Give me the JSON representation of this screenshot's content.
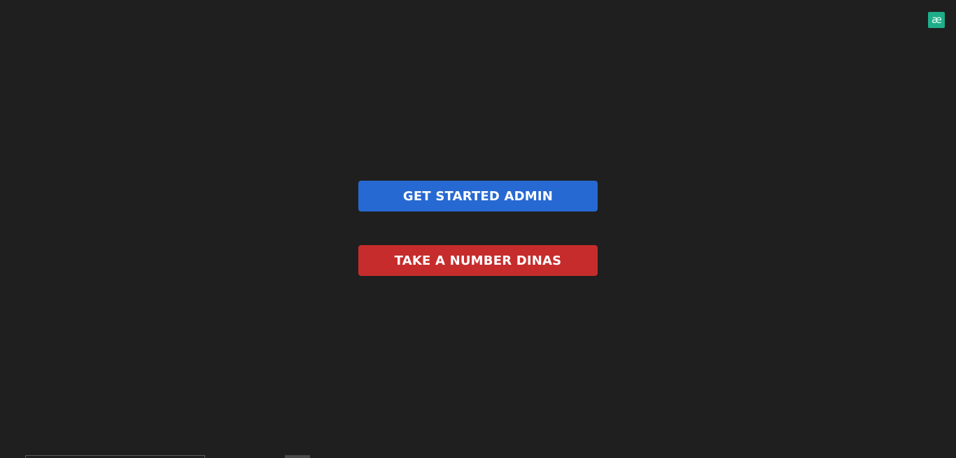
{
  "badge": {
    "icon": "ae-logo-icon",
    "text": "æ",
    "color": "#1fae8a"
  },
  "buttons": {
    "admin_label": "GET STARTED ADMIN",
    "dinas_label": "TAKE A NUMBER DINAS"
  },
  "colors": {
    "background": "#1f1f1f",
    "admin_button": "#2769d2",
    "dinas_button": "#c62c2c"
  }
}
